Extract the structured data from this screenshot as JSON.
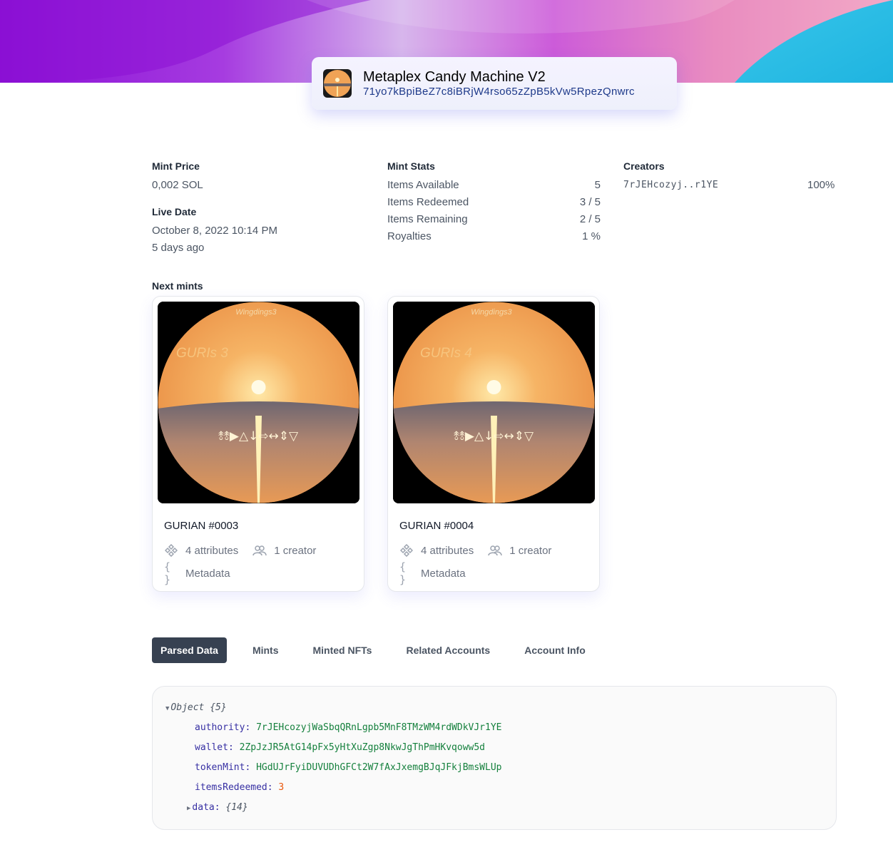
{
  "header": {
    "title": "Metaplex Candy Machine V2",
    "address": "71yo7kBpiBeZ7c8iBRjW4rso65zZpB5kVw5RpezQnwrc"
  },
  "mint_price": {
    "label": "Mint Price",
    "value": "0,002 SOL"
  },
  "live_date": {
    "label": "Live Date",
    "date": "October 8, 2022 10:14 PM",
    "relative": "5 days ago"
  },
  "mint_stats": {
    "label": "Mint Stats",
    "rows": [
      {
        "name": "Items Available",
        "value": "5"
      },
      {
        "name": "Items Redeemed",
        "value": "3 / 5"
      },
      {
        "name": "Items Remaining",
        "value": "2 / 5"
      },
      {
        "name": "Royalties",
        "value": "1 %"
      }
    ]
  },
  "creators": {
    "label": "Creators",
    "rows": [
      {
        "address": "7rJEHcozyj..r1YE",
        "share": "100%"
      }
    ]
  },
  "next_mints": {
    "label": "Next mints",
    "items": [
      {
        "name": "GURIAN #0003",
        "image_text": "GURIs 3",
        "font_text": "Wingdings3",
        "symbols": "⥉⥉▶△↓⇨↔⇕▽",
        "attributes": "4 attributes",
        "creators": "1 creator",
        "metadata": "Metadata"
      },
      {
        "name": "GURIAN #0004",
        "image_text": "GURIs 4",
        "font_text": "Wingdings3",
        "symbols": "⥉⥉▶△↓⇨↔⇕▽",
        "attributes": "4 attributes",
        "creators": "1 creator",
        "metadata": "Metadata"
      }
    ]
  },
  "tabs": [
    "Parsed Data",
    "Mints",
    "Minted NFTs",
    "Related Accounts",
    "Account Info"
  ],
  "parsed": {
    "root_label": "Object",
    "root_count": "{5}",
    "fields": [
      {
        "key": "authority:",
        "value": "7rJEHcozyjWaSbqQRnLgpb5MnF8TMzWM4rdWDkVJr1YE",
        "kind": "string"
      },
      {
        "key": "wallet:",
        "value": "2ZpJzJR5AtG14pFx5yHtXuZgp8NkwJgThPmHKvqoww5d",
        "kind": "string"
      },
      {
        "key": "tokenMint:",
        "value": "HGdUJrFyiDUVUDhGFCt2W7fAxJxemgBJqJFkjBmsWLUp",
        "kind": "string"
      },
      {
        "key": "itemsRedeemed:",
        "value": "3",
        "kind": "number"
      }
    ],
    "data_key": "data:",
    "data_count": "{14}"
  }
}
